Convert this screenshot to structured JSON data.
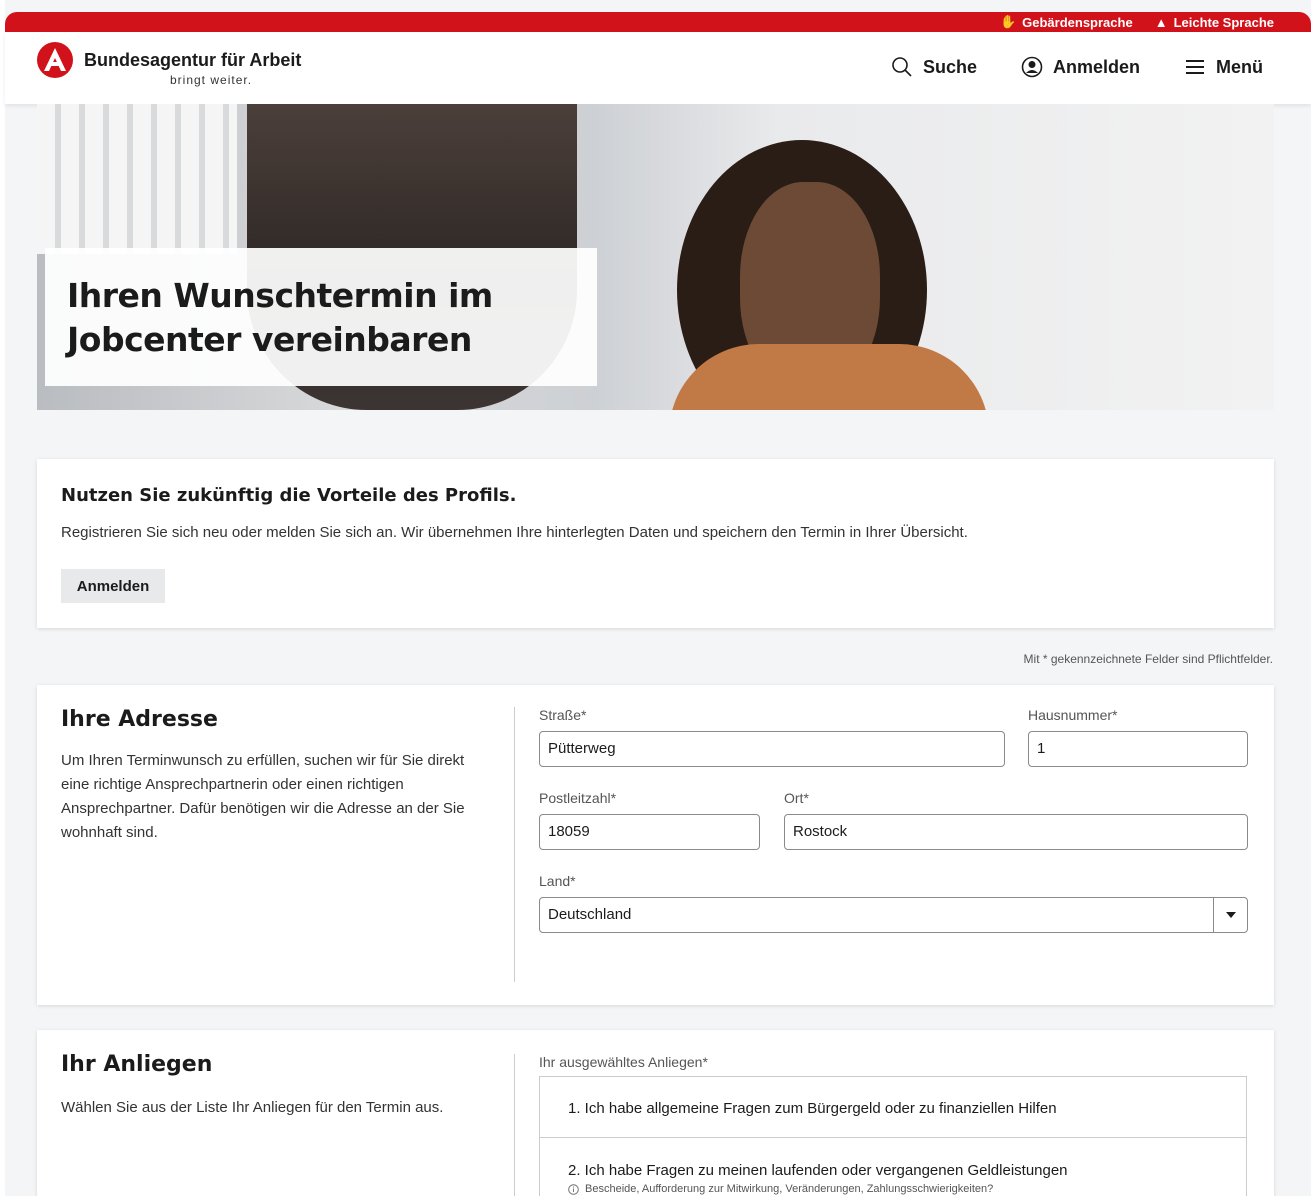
{
  "topbar": {
    "sign_language": "Gebärdensprache",
    "easy_language": "Leichte Sprache"
  },
  "header": {
    "brand": "Bundesagentur für Arbeit",
    "tagline": "bringt weiter.",
    "search": "Suche",
    "login": "Anmelden",
    "menu": "Menü"
  },
  "hero": {
    "title": "Ihren Wunschtermin im Jobcenter vereinbaren"
  },
  "promo": {
    "heading": "Nutzen Sie zukünftig die Vorteile des Profils.",
    "text": "Registrieren Sie sich neu oder melden Sie sich an. Wir übernehmen Ihre hinterlegten Daten und speichern den Termin in Ihrer Übersicht.",
    "button": "Anmelden"
  },
  "required_hint": "Mit * gekennzeichnete Felder sind Pflichtfelder.",
  "address": {
    "heading": "Ihre Adresse",
    "description": "Um Ihren Terminwunsch zu erfüllen, suchen wir für Sie direkt eine richtige Ansprechpartnerin oder einen richtigen Ansprechpartner. Dafür benötigen wir die Adresse an der Sie wohnhaft sind.",
    "street_label": "Straße*",
    "street_value": "Pütterweg",
    "house_label": "Hausnummer*",
    "house_value": "1",
    "zip_label": "Postleitzahl*",
    "zip_value": "18059",
    "city_label": "Ort*",
    "city_value": "Rostock",
    "country_label": "Land*",
    "country_value": "Deutschland"
  },
  "concern": {
    "heading": "Ihr Anliegen",
    "description": "Wählen Sie aus der Liste Ihr Anliegen für den Termin aus.",
    "select_label": "Ihr ausgewähltes Anliegen*",
    "option1": "1. Ich habe allgemeine Fragen zum Bürgergeld oder zu finanziellen Hilfen",
    "option2": "2. Ich habe Fragen zu meinen laufenden oder vergangenen Geldleistungen",
    "option2_sub": "Bescheide, Aufforderung zur Mitwirkung, Veränderungen, Zahlungsschwierigkeiten?"
  },
  "colors": {
    "brand_red": "#d2121b",
    "page_bg": "#f4f5f7"
  }
}
